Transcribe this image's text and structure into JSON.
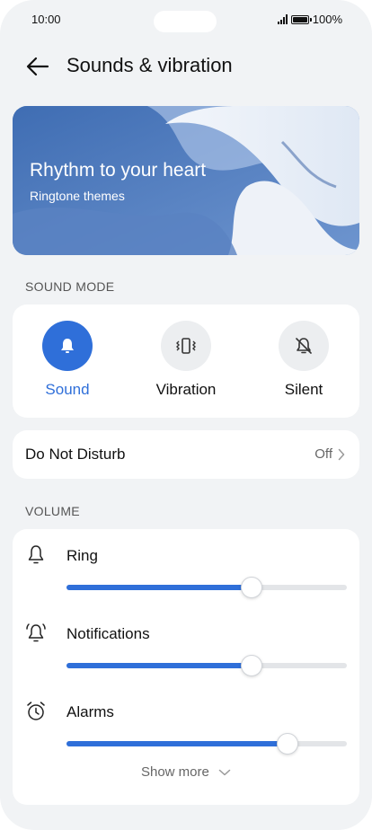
{
  "status_bar": {
    "time": "10:00",
    "battery": "100%"
  },
  "header": {
    "title": "Sounds & vibration"
  },
  "banner": {
    "title": "Rhythm to your heart",
    "subtitle": "Ringtone themes"
  },
  "sound_mode": {
    "section_label": "SOUND MODE",
    "modes": [
      {
        "label": "Sound",
        "icon": "bell-icon",
        "active": true
      },
      {
        "label": "Vibration",
        "icon": "vibration-icon",
        "active": false
      },
      {
        "label": "Silent",
        "icon": "bell-off-icon",
        "active": false
      }
    ]
  },
  "dnd": {
    "label": "Do Not Disturb",
    "value": "Off"
  },
  "volume": {
    "section_label": "VOLUME",
    "rows": [
      {
        "label": "Ring",
        "icon": "bell-outline-icon",
        "level": 0.66
      },
      {
        "label": "Notifications",
        "icon": "notification-bell-icon",
        "level": 0.66
      },
      {
        "label": "Alarms",
        "icon": "alarm-clock-icon",
        "level": 0.79
      }
    ],
    "show_more": "Show more"
  },
  "colors": {
    "accent": "#2f6fd9",
    "background": "#f1f3f5",
    "card": "#ffffff"
  }
}
